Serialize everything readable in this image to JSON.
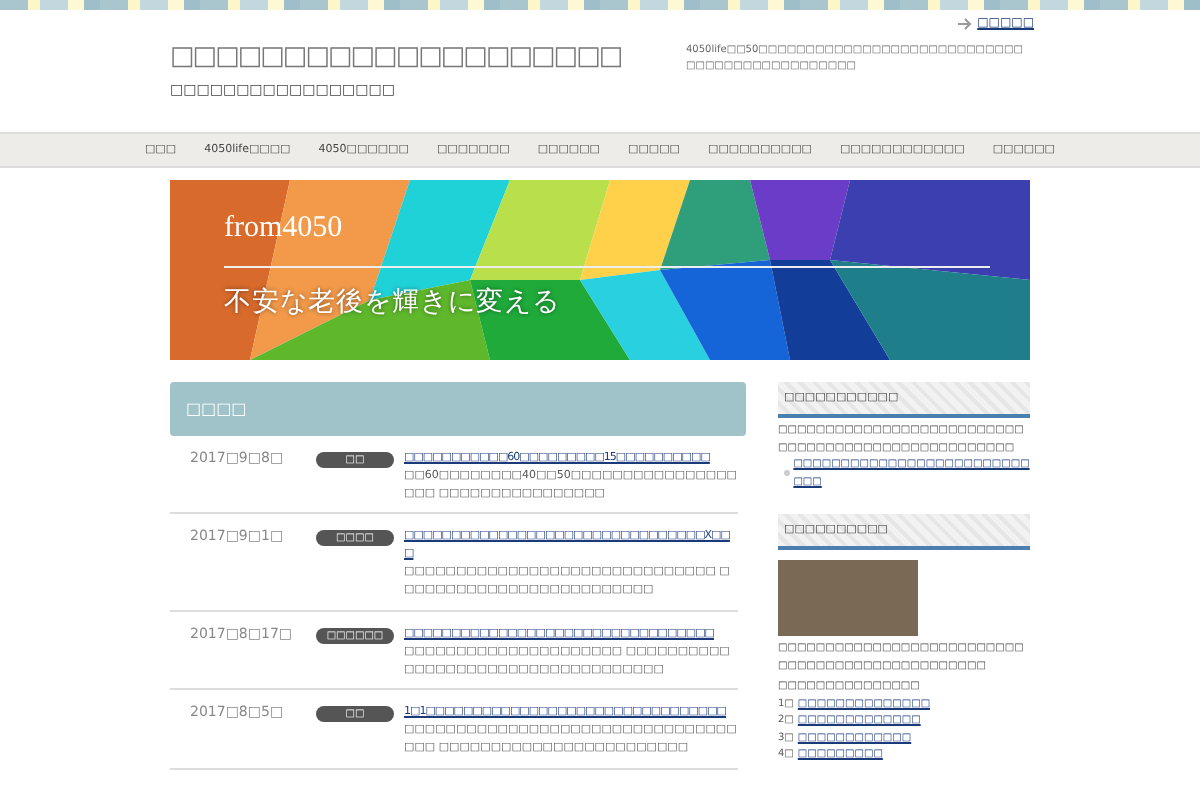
{
  "top_link": "□□□□□",
  "site": {
    "title": "□□□□□□□□□□□□□□□□□□□□",
    "tagline": "□□□□□□□□□□□□□□□□□",
    "description": "4050life□□50□□□□□□□□□□□□□□□□□□□□□□□□□□□□□□□□□□□□□□□□□□□□□□"
  },
  "nav": [
    {
      "label": "□□□"
    },
    {
      "label": "4050life□□□□"
    },
    {
      "label": "4050□□□□□□"
    },
    {
      "label": "□□□□□□□"
    },
    {
      "label": "□□□□□□"
    },
    {
      "label": "□□□□□"
    },
    {
      "label": "□□□□□□□□□□"
    },
    {
      "label": "□□□□□□□□□□□□"
    },
    {
      "label": "□□□□□□"
    }
  ],
  "banner": {
    "title": "from4050",
    "subtitle": "不安な老後を輝きに変える"
  },
  "section_title": "□□□□",
  "posts": [
    {
      "date": "2017□9□8□",
      "category": "□□",
      "title": "□□□□□□□□□□□60□□□□□□□□□15□□□□□□□□□□",
      "excerpt": "□□60□□□□□□□□40□□50□□□□□□□□□□□□□□□□□□□ □□□□□□□□□□□□□□□□"
    },
    {
      "date": "2017□9□1□",
      "category": "□□□□",
      "title": "□□□□□□□□□□□□□□□□□□□□□□□□□□□□□□□□X□□□",
      "excerpt": "□□□□□□□□□□□□□□□□□□□□□□□□□□□□□□ □□□□□□□□□□□□□□□□□□□□□□□□□"
    },
    {
      "date": "2017□8□17□",
      "category": "□□□□□□",
      "title": "□□□□□□□□□□□□□□□□□□□□□□□□□□□□□□□□□",
      "excerpt": "□□□□□□□□□□□□□□□□□□□□□ □□□□□□□□□□□□□□□□□□□□□□□□□□□□□□□□□□□"
    },
    {
      "date": "2017□8□5□",
      "category": "□□",
      "title": "1□1□□□□□□□□□□□□□□□□□□□□□□□□□□□□□□□□",
      "excerpt": "□□□□□□□□□□□□□□□□□□□□□□□□□□□□□□□□□□□ □□□□□□□□□□□□□□□□□□□□□□□□"
    }
  ],
  "sidebar": [
    {
      "title": "□□□□□□□□□□□",
      "text": "□□□□□□□□□□□□□□□□□□□□□□□□□□□□□□□□□□□□□□□□□□□□□□□□□□□",
      "links": [
        "□□□□□□□□□□□□□□□□□□□□□□□□□□□□"
      ]
    },
    {
      "title": "□□□□□□□□□□",
      "photo": true,
      "text": "□□□□□□□□□□□□□□□□□□□□□□□□□□□□□□□□□□□□□□□□□□□□□□□□",
      "lines": [
        "□□□□□□□□□□□□□□□"
      ],
      "numbered": [
        {
          "num": "1□",
          "label": "□□□□□□□□□□□□□□"
        },
        {
          "num": "2□",
          "label": "□□□□□□□□□□□□□"
        },
        {
          "num": "3□",
          "label": "□□□□□□□□□□□□"
        },
        {
          "num": "4□",
          "label": "□□□□□□□□□"
        }
      ]
    }
  ]
}
